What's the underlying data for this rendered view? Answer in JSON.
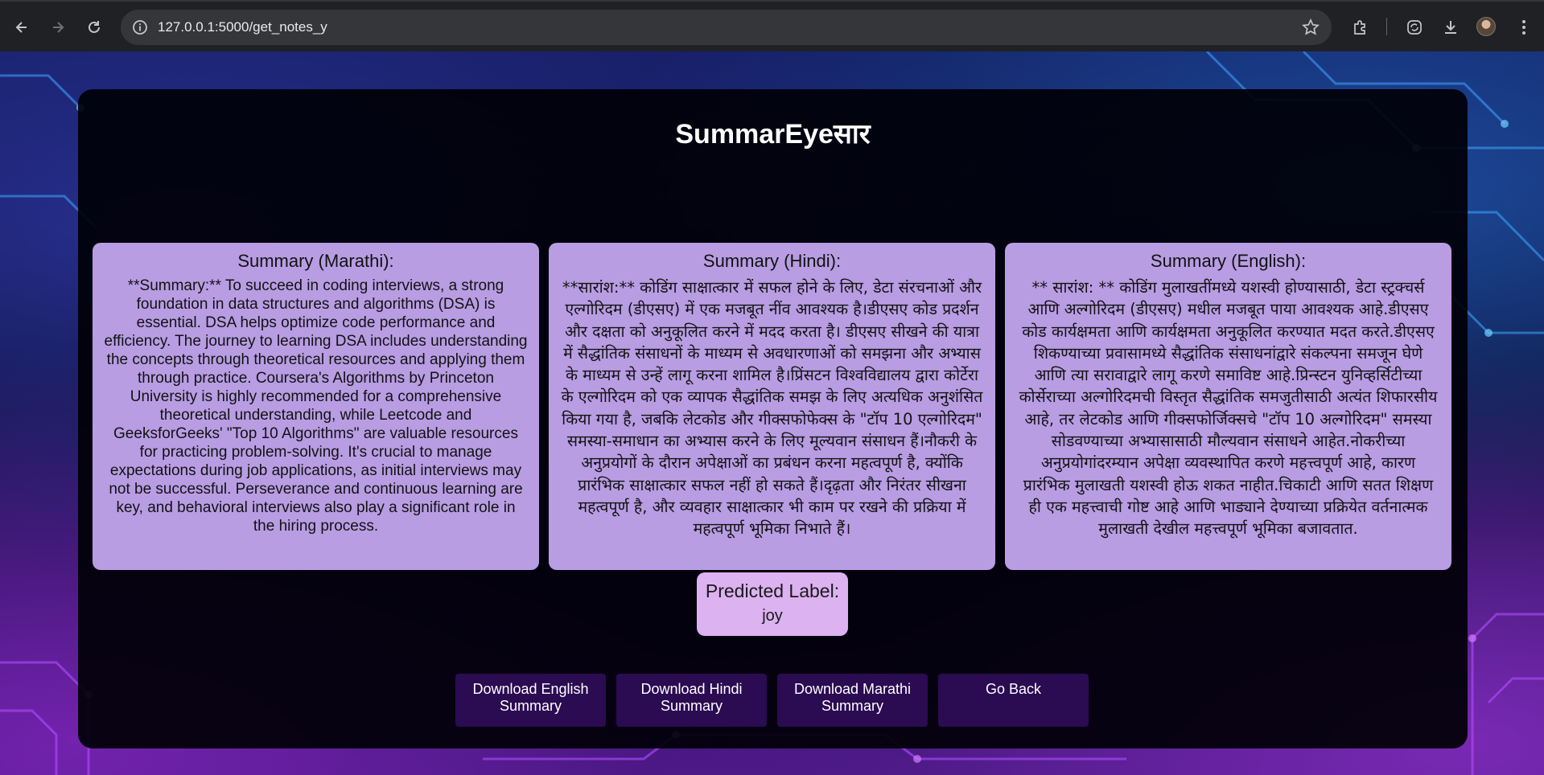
{
  "browser": {
    "url": "127.0.0.1:5000/get_notes_y"
  },
  "app": {
    "title": "SummarEyeसार"
  },
  "cards": [
    {
      "heading": "Summary (Marathi):",
      "text": "**Summary:** To succeed in coding interviews, a strong foundation in data structures and algorithms (DSA) is essential. DSA helps optimize code performance and efficiency. The journey to learning DSA includes understanding the concepts through theoretical resources and applying them through practice. Coursera's Algorithms by Princeton University is highly recommended for a comprehensive theoretical understanding, while Leetcode and GeeksforGeeks' \"Top 10 Algorithms\" are valuable resources for practicing problem-solving. It's crucial to manage expectations during job applications, as initial interviews may not be successful. Perseverance and continuous learning are key, and behavioral interviews also play a significant role in the hiring process."
    },
    {
      "heading": "Summary (Hindi):",
      "text": "**सारांश:** कोडिंग साक्षात्कार में सफल होने के लिए, डेटा संरचनाओं और एल्गोरिदम (डीएसए) में एक मजबूत नींव आवश्यक है।डीएसए कोड प्रदर्शन और दक्षता को अनुकूलित करने में मदद करता है। डीएसए सीखने की यात्रा में सैद्धांतिक संसाधनों के माध्यम से अवधारणाओं को समझना और अभ्यास के माध्यम से उन्हें लागू करना शामिल है।प्रिंसटन विश्वविद्यालय द्वारा कोर्टेरा के एल्गोरिदम को एक व्यापक सैद्धांतिक समझ के लिए अत्यधिक अनुशंसित किया गया है, जबकि लेटकोड और गीक्सफोफेक्स के \"टॉप 10 एल्गोरिदम\" समस्या-समाधान का अभ्यास करने के लिए मूल्यवान संसाधन हैं।नौकरी के अनुप्रयोगों के दौरान अपेक्षाओं का प्रबंधन करना महत्वपूर्ण है, क्योंकि प्रारंभिक साक्षात्कार सफल नहीं हो सकते हैं।दृढ़ता और निरंतर सीखना महत्वपूर्ण है, और व्यवहार साक्षात्कार भी काम पर रखने की प्रक्रिया में महत्वपूर्ण भूमिका निभाते हैं।"
    },
    {
      "heading": "Summary (English):",
      "text": "** सारांश: ** कोडिंग मुलाखतींमध्ये यशस्वी होण्यासाठी, डेटा स्ट्रक्चर्स आणि अल्गोरिदम (डीएसए) मधील मजबूत पाया आवश्यक आहे.डीएसए कोड कार्यक्षमता आणि कार्यक्षमता अनुकूलित करण्यात मदत करते.डीएसए शिकण्याच्या प्रवासामध्ये सैद्धांतिक संसाधनांद्वारे संकल्पना समजून घेणे आणि त्या सरावाद्वारे लागू करणे समाविष्ट आहे.प्रिन्स्टन युनिव्हर्सिटीच्या कोर्सेराच्या अल्गोरिदमची विस्तृत सैद्धांतिक समजुतीसाठी अत्यंत शिफारसीय आहे, तर लेटकोड आणि गीक्सफोर्जिक्सचे \"टॉप 10 अल्गोरिदम\" समस्या सोडवण्याच्या अभ्यासासाठी मौल्यवान संसाधने आहेत.नोकरीच्या अनुप्रयोगांदरम्यान अपेक्षा व्यवस्थापित करणे महत्त्वपूर्ण आहे, कारण प्रारंभिक मुलाखती यशस्वी होऊ शकत नाहीत.चिकाटी आणि सतत शिक्षण ही एक महत्त्वाची गोष्ट आहे आणि भाड्याने देण्याच्या प्रक्रियेत वर्तनात्मक मुलाखती देखील महत्त्वपूर्ण भूमिका बजावतात."
    }
  ],
  "prediction": {
    "heading": "Predicted Label:",
    "value": "joy"
  },
  "buttons": {
    "download_english": "Download English Summary",
    "download_hindi": "Download Hindi Summary",
    "download_marathi": "Download Marathi Summary",
    "go_back": "Go Back"
  },
  "icons": {
    "back": "back-arrow-icon",
    "forward": "forward-arrow-icon",
    "reload": "reload-icon",
    "site_info": "site-info-icon",
    "bookmark": "star-icon",
    "extensions": "puzzle-icon",
    "sync": "sync-icon",
    "download": "download-icon",
    "menu": "kebab-menu-icon"
  },
  "colors": {
    "card_bg": "#b89de3",
    "label_bg": "#dcb2f0",
    "button_bg": "#2b0b52",
    "panel_bg": "#000006"
  }
}
